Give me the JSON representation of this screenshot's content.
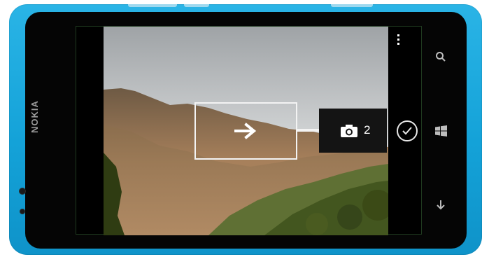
{
  "device": {
    "brand": "NOKIA",
    "body_color": "#1aa8de"
  },
  "camera": {
    "panorama_count": "2",
    "icons": {
      "menu": "ellipsis-vertical-icon",
      "arrow": "arrow-right-icon",
      "camera": "camera-icon",
      "accept": "checkmark-circle-icon"
    }
  },
  "hardware_keys": {
    "search": "search-icon",
    "start": "windows-logo-icon",
    "back": "back-arrow-icon"
  }
}
